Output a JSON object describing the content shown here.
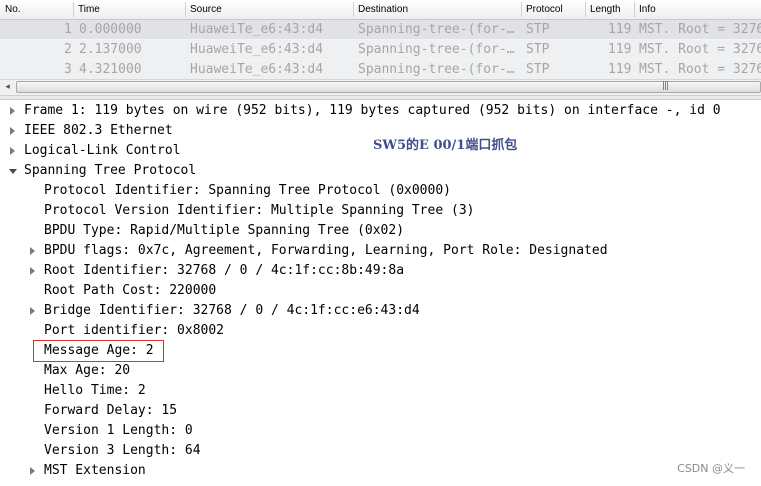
{
  "packet_list": {
    "columns": [
      "No.",
      "Time",
      "Source",
      "Destination",
      "Protocol",
      "Length",
      "Info"
    ],
    "rows": [
      {
        "no": "1",
        "time": "0.000000",
        "source": "HuaweiTe_e6:43:d4",
        "destination": "Spanning-tree-(for-…",
        "protocol": "STP",
        "length": "119",
        "info": "MST. Root = 3276"
      },
      {
        "no": "2",
        "time": "2.137000",
        "source": "HuaweiTe_e6:43:d4",
        "destination": "Spanning-tree-(for-…",
        "protocol": "STP",
        "length": "119",
        "info": "MST. Root = 3276"
      },
      {
        "no": "3",
        "time": "4.321000",
        "source": "HuaweiTe_e6:43:d4",
        "destination": "Spanning-tree-(for-…",
        "protocol": "STP",
        "length": "119",
        "info": "MST. Root = 3276"
      }
    ],
    "scroll_left_glyph": "◂",
    "scroll_grip": "|||"
  },
  "details": {
    "frame": "Frame 1: 119 bytes on wire (952 bits), 119 bytes captured (952 bits) on interface -, id 0",
    "ethernet": "IEEE 802.3 Ethernet",
    "llc": "Logical-Link Control",
    "stp": "Spanning Tree Protocol",
    "fields": {
      "protocol_id": "Protocol Identifier: Spanning Tree Protocol (0x0000)",
      "protocol_version": "Protocol Version Identifier: Multiple Spanning Tree (3)",
      "bpdu_type": "BPDU Type: Rapid/Multiple Spanning Tree (0x02)",
      "bpdu_flags": "BPDU flags: 0x7c, Agreement, Forwarding, Learning, Port Role: Designated",
      "root_id": "Root Identifier: 32768 / 0 / 4c:1f:cc:8b:49:8a",
      "root_path_cost": "Root Path Cost: 220000",
      "bridge_id": "Bridge Identifier: 32768 / 0 / 4c:1f:cc:e6:43:d4",
      "port_id": "Port identifier: 0x8002",
      "message_age": "Message Age: 2",
      "max_age": "Max Age: 20",
      "hello_time": "Hello Time: 2",
      "forward_delay": "Forward Delay: 15",
      "v1_length": "Version 1 Length: 0",
      "v3_length": "Version 3 Length: 64",
      "mst_extension": "MST Extension"
    }
  },
  "annotation": "SW5的E 00/1端口抓包",
  "watermark": "CSDN @义一",
  "colors": {
    "highlight_border": "#e0322d",
    "annotation_text": "#3f4f8c",
    "row_background": "#eef0f2",
    "row_text": "#a6a6a6"
  }
}
